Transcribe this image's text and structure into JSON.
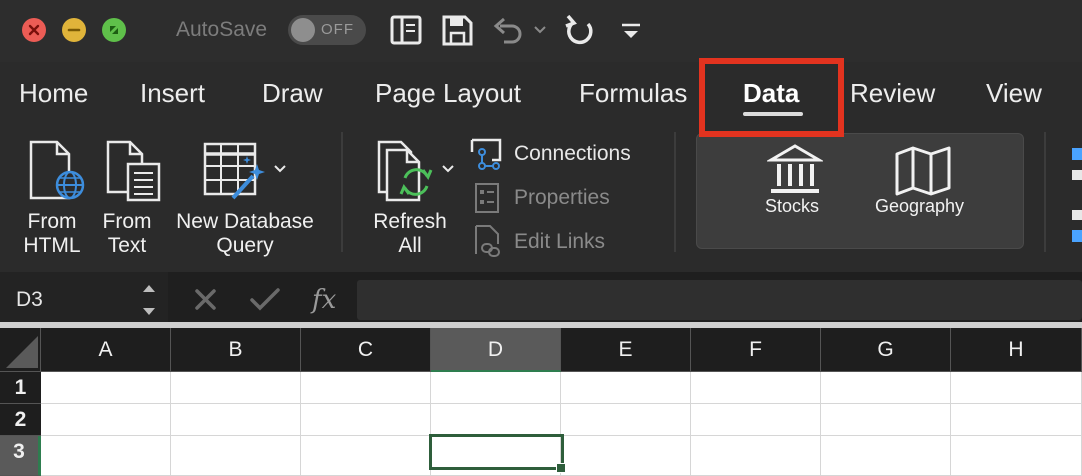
{
  "titlebar": {
    "autosave_label": "AutoSave",
    "autosave_state": "OFF"
  },
  "tabs": [
    {
      "label": "Home"
    },
    {
      "label": "Insert"
    },
    {
      "label": "Draw"
    },
    {
      "label": "Page Layout"
    },
    {
      "label": "Formulas"
    },
    {
      "label": "Data",
      "active": true
    },
    {
      "label": "Review"
    },
    {
      "label": "View"
    }
  ],
  "ribbon": {
    "from_html": {
      "line1": "From",
      "line2": "HTML"
    },
    "from_text": {
      "line1": "From",
      "line2": "Text"
    },
    "new_db_query": {
      "line1": "New Database",
      "line2": "Query"
    },
    "refresh_all": {
      "line1": "Refresh",
      "line2": "All"
    },
    "connections": "Connections",
    "properties": "Properties",
    "edit_links": "Edit Links",
    "stocks": "Stocks",
    "geography": "Geography"
  },
  "formula_bar": {
    "name_box": "D3",
    "formula": ""
  },
  "grid": {
    "columns": [
      "A",
      "B",
      "C",
      "D",
      "E",
      "F",
      "G",
      "H"
    ],
    "rows": [
      "1",
      "2",
      "3"
    ],
    "selected_column": "D",
    "selected_row": "3"
  },
  "colors": {
    "highlight": "#e2331f",
    "selection_green": "#2e5e3b",
    "link_blue": "#4aa3ff"
  }
}
